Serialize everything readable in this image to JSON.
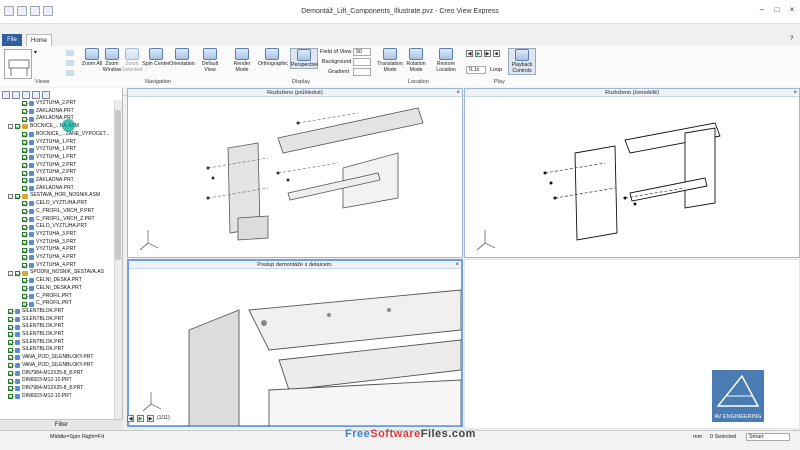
{
  "window": {
    "title": "Demontáž_Lift_Components_Illustrate.pvz - Creo View Express"
  },
  "tabs": {
    "file": "File",
    "home": "Home"
  },
  "ribbon": {
    "views_group": "Views",
    "navigation_group": "Navigation",
    "display_group": "Display",
    "location_group": "Location",
    "play_group": "Play",
    "buttons": {
      "zoom_all": "Zoom All",
      "zoom_window": "Zoom Window",
      "zoom_selected": "Zoom Selected",
      "spin_center": "Spin Center",
      "orientation": "Orientation",
      "default_view": "Default View",
      "render_mode": "Render Mode",
      "orthographic": "Orthographic",
      "perspective": "Perspective",
      "translation_mode": "Translation Mode",
      "rotation_mode": "Rotation Mode",
      "restore_location": "Restore Location",
      "playback_controls": "Playback Controls"
    },
    "fields": {
      "fov_label": "Field of View",
      "fov_value": "50",
      "background_label": "Background",
      "gradient_label": "Gradient"
    },
    "play": {
      "speed": "0.1x",
      "loop": "Loop"
    }
  },
  "tree": {
    "items": [
      {
        "label": "VYZTUHA_2.PRT",
        "type": "part",
        "level": 2
      },
      {
        "label": "ZAKLADNA.PRT",
        "type": "part",
        "level": 2
      },
      {
        "label": "ZAKLADNA.PRT",
        "type": "part",
        "level": 2
      },
      {
        "label": "BOCNICE_...NA.ASM",
        "type": "asm",
        "level": 1
      },
      {
        "label": "BOCNICE_...ZANE_VYPOCET...",
        "type": "part",
        "level": 2
      },
      {
        "label": "VYZTUHA_1.PRT",
        "type": "part",
        "level": 2
      },
      {
        "label": "VYZTUHA_1.PRT",
        "type": "part",
        "level": 2
      },
      {
        "label": "VYZTUHA_1.PRT",
        "type": "part",
        "level": 2
      },
      {
        "label": "VYZTUHA_2.PRT",
        "type": "part",
        "level": 2
      },
      {
        "label": "VYZTUHA_2.PRT",
        "type": "part",
        "level": 2
      },
      {
        "label": "ZAKLADNA.PRT",
        "type": "part",
        "level": 2
      },
      {
        "label": "ZAKLADNA.PRT",
        "type": "part",
        "level": 2
      },
      {
        "label": "SESTAVA_HOR_NOSNIK.ASM",
        "type": "asm",
        "level": 1
      },
      {
        "label": "CELO_VYZTUHA.PRT",
        "type": "part",
        "level": 2
      },
      {
        "label": "C_PROFIL_VRCH_P.PRT",
        "type": "part",
        "level": 2
      },
      {
        "label": "C_PROFIL_VRCH_Z.PRT",
        "type": "part",
        "level": 2
      },
      {
        "label": "CELO_VYZTUHA.PRT",
        "type": "part",
        "level": 2
      },
      {
        "label": "VYZTUHA_3.PRT",
        "type": "part",
        "level": 2
      },
      {
        "label": "VYZTUHA_3.PRT",
        "type": "part",
        "level": 2
      },
      {
        "label": "VYZTUHA_4.PRT",
        "type": "part",
        "level": 2
      },
      {
        "label": "VYZTUHA_4.PRT",
        "type": "part",
        "level": 2
      },
      {
        "label": "VYZTUHA_4.PRT",
        "type": "part",
        "level": 2
      },
      {
        "label": "SPODNI_NOSNIK_SESTAVA.AS",
        "type": "asm",
        "level": 1
      },
      {
        "label": "CELNI_DESKA.PRT",
        "type": "part",
        "level": 2
      },
      {
        "label": "CELNI_DESKA.PRT",
        "type": "part",
        "level": 2
      },
      {
        "label": "C_PROFIL.PRT",
        "type": "part",
        "level": 2
      },
      {
        "label": "C_PROFIL.PRT",
        "type": "part",
        "level": 2
      },
      {
        "label": "SILENTBLOK.PRT",
        "type": "part",
        "level": 1
      },
      {
        "label": "SILENTBLOK.PRT",
        "type": "part",
        "level": 1
      },
      {
        "label": "SILENTBLOK.PRT",
        "type": "part",
        "level": 1
      },
      {
        "label": "SILENTBLOK.PRT",
        "type": "part",
        "level": 1
      },
      {
        "label": "SILENTBLOK.PRT",
        "type": "part",
        "level": 1
      },
      {
        "label": "SILENTBLOK.PRT",
        "type": "part",
        "level": 1
      },
      {
        "label": "VANA_POD_SILENBLOKY.PRT",
        "type": "part",
        "level": 1
      },
      {
        "label": "VANA_POD_SILENBLOKY.PRT",
        "type": "part",
        "level": 1
      },
      {
        "label": "DIN7984-M12X25-8_8.PRT",
        "type": "part",
        "level": 1
      },
      {
        "label": "DIN6923-M12-10.PRT",
        "type": "part",
        "level": 1
      },
      {
        "label": "DIN7984-M12X25-8_8.PRT",
        "type": "part",
        "level": 1
      },
      {
        "label": "DIN6923-M12-10.PRT",
        "type": "part",
        "level": 1
      }
    ],
    "filter_label": "Filter"
  },
  "viewports": {
    "top_left": "Rozloženo (průhledné)",
    "top_right": "Rozloženo (černobílé)",
    "bottom_left": "Postup demontáže s detaicem."
  },
  "player": {
    "frame": "(1/11)"
  },
  "status": {
    "left": "Middle=Spin  Right=Fit",
    "units": "mm",
    "selected": "0 Selected",
    "mode": "Smart"
  },
  "logo": {
    "text": "AV ENGINEERING"
  },
  "watermark": {
    "part1": "Free",
    "part2": "Software",
    "part3": "Files.com"
  },
  "colors": {
    "accent": "#2f5f9e",
    "viewport_border": "#6ea0e8",
    "logo_bg": "#4a7bb2"
  }
}
